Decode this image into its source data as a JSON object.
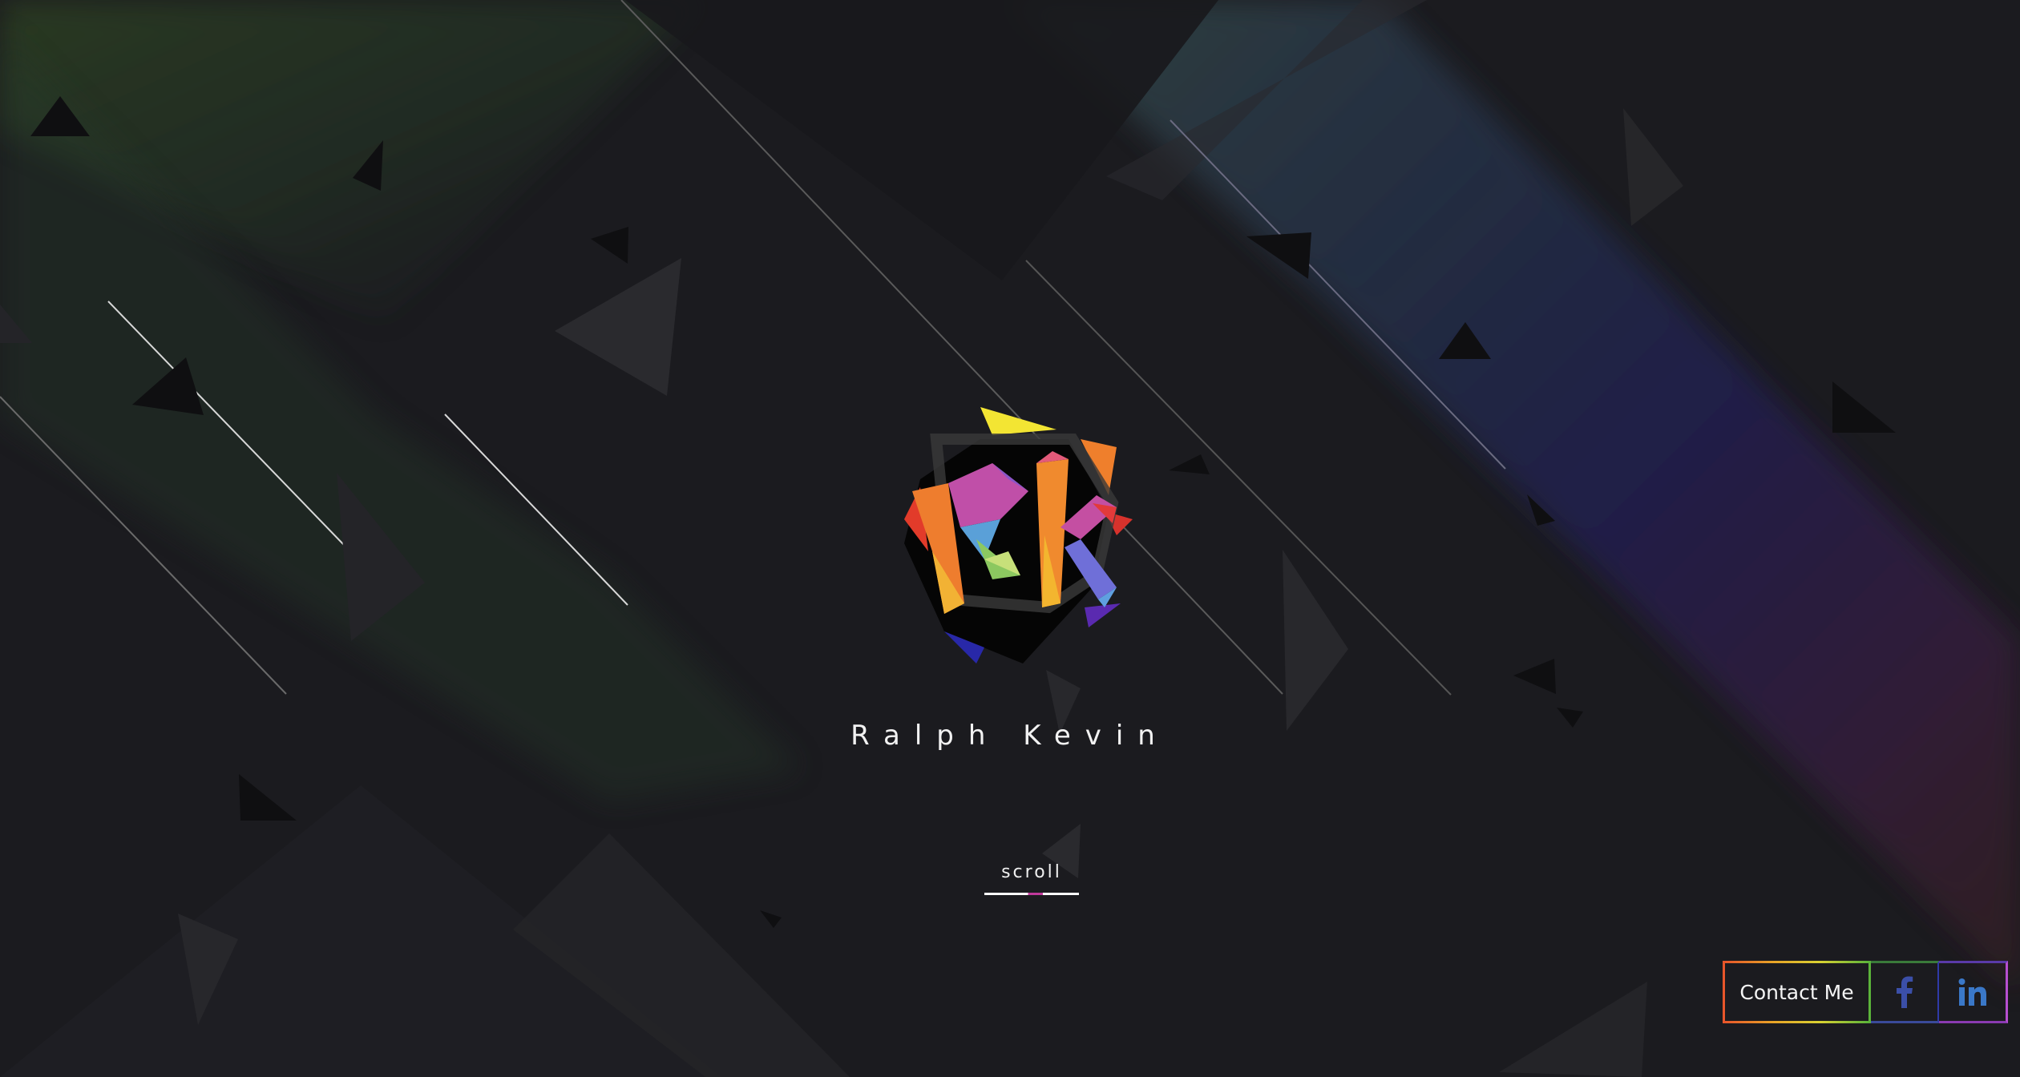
{
  "hero": {
    "name": "Ralph Kevin",
    "logo_alt": "RK"
  },
  "scroll": {
    "label": "scroll"
  },
  "contact": {
    "label": "Contact Me",
    "facebook_icon": "facebook-icon",
    "linkedin_icon": "linkedin-icon"
  },
  "colors": {
    "background": "#1b1b1f",
    "accent_pink": "#c0399b",
    "facebook": "#3b4fa8",
    "linkedin": "#3a78c8"
  }
}
